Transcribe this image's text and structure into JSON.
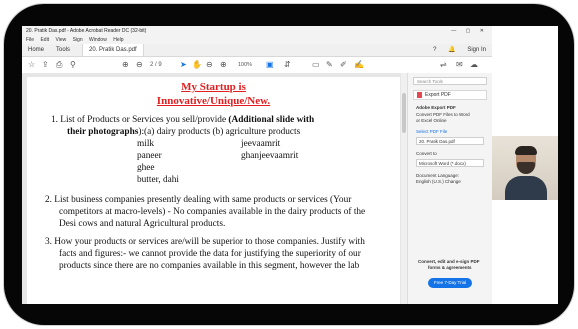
{
  "window": {
    "title": "20. Pratik Das.pdf - Adobe Acrobat Reader DC (32-bit)",
    "controls": "— ▢ ✕"
  },
  "menubar": [
    "File",
    "Edit",
    "View",
    "Sign",
    "Window",
    "Help"
  ],
  "tabs": {
    "home": "Home",
    "tools": "Tools",
    "document": "20. Pratik Das.pdf",
    "help": "?",
    "sign_in": "Sign In"
  },
  "toolbar": {
    "page_current": "2",
    "page_total": "/ 9",
    "zoom": "100%"
  },
  "document": {
    "title_line1": "My Startup is",
    "title_line2": "Innovative/Unique/New.",
    "item1_line1_prefix": "1.  List of Products or Services you sell/provide ",
    "item1_line1_bold": "(Additional slide with",
    "item1_line2_bold": "their  photographs",
    "item1_line2_rest": "):(a) dairy products     (b) agriculture products",
    "products_left": [
      "milk",
      "paneer",
      "ghee",
      "butter, dahi"
    ],
    "products_right": [
      "jeevaamrit",
      "ghanjeevaamrit"
    ],
    "item2": [
      "2.  List business companies presently dealing with same products or services (Your",
      "competitors at macro-levels) - No companies available in the dairy products of the",
      "Desi cows and natural Agricultural products."
    ],
    "item3": [
      "3. How your products or services are/will be superior to those companies. Justify with",
      "facts   and figures:- we cannot provide the data for justifying the superiority of our",
      "products since there are no companies available in this segment, however the lab"
    ]
  },
  "right_pane": {
    "search_placeholder": "Search Tools",
    "export_button": "Export PDF",
    "export_heading": "Adobe Export PDF",
    "export_desc": [
      "Convert PDF Files to Word",
      "or Excel Online"
    ],
    "select_label": "Select PDF File",
    "selected_file": "20. Pratik Das.pdf",
    "convert_label": "Convert to",
    "convert_value": "Microsoft Word (*.docx)",
    "language_label": "Document Language:",
    "language_value": "English (U.S.)  Change",
    "promo": [
      "Convert, edit and e-sign PDF",
      "forms & agreements"
    ],
    "trial_button": "Free 7-Day Trial"
  }
}
